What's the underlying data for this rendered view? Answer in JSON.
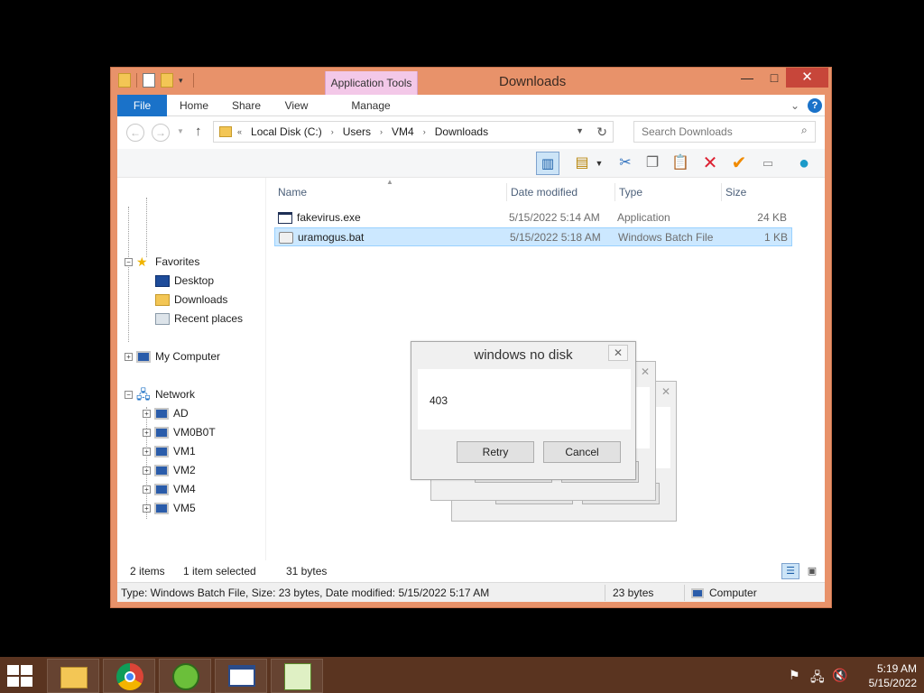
{
  "window": {
    "title": "Downloads",
    "context_tab_group": "Application Tools",
    "min_symbol": "—",
    "max_symbol": "□",
    "close_symbol": "✕"
  },
  "ribbon": {
    "tabs": [
      "File",
      "Home",
      "Share",
      "View",
      "Manage"
    ],
    "help_symbol": "?"
  },
  "address_bar": {
    "overflow": "«",
    "crumbs": [
      "Local Disk (C:)",
      "Users",
      "VM4",
      "Downloads"
    ],
    "search_placeholder": "Search Downloads"
  },
  "nav_pane": {
    "favorites": {
      "label": "Favorites",
      "items": [
        "Desktop",
        "Downloads",
        "Recent places"
      ]
    },
    "computer": {
      "label": "My Computer"
    },
    "network": {
      "label": "Network",
      "items": [
        "AD",
        "VM0B0T",
        "VM1",
        "VM2",
        "VM4",
        "VM5"
      ]
    }
  },
  "file_list": {
    "columns": [
      "Name",
      "Date modified",
      "Type",
      "Size"
    ],
    "rows": [
      {
        "name": "fakevirus.exe",
        "date": "5/15/2022 5:14 AM",
        "type": "Application",
        "size": "24 KB",
        "selected": false
      },
      {
        "name": "uramogus.bat",
        "date": "5/15/2022 5:18 AM",
        "type": "Windows Batch File",
        "size": "1 KB",
        "selected": true
      }
    ]
  },
  "status": {
    "count": "2 items",
    "selection": "1 item selected",
    "bytes": "31 bytes"
  },
  "details_bar": {
    "description": "Type: Windows Batch File, Size: 23 bytes, Date modified: 5/15/2022 5:17 AM",
    "size": "23 bytes",
    "location": "Computer"
  },
  "dialog": {
    "title": "windows no disk",
    "message": "403",
    "buttons": [
      "Retry",
      "Cancel"
    ],
    "close_symbol": "✕"
  },
  "taskbar": {
    "apps": [
      "file-explorer",
      "chrome",
      "frog-app",
      "window-app",
      "notepad-app"
    ],
    "time": "5:19 AM",
    "date": "5/15/2022"
  },
  "colors": {
    "window_frame": "#e8926a",
    "file_tab": "#1a72c9",
    "app_tools": "#f3c8e8",
    "selection": "#cce8ff",
    "taskbar": "#5a3420"
  }
}
